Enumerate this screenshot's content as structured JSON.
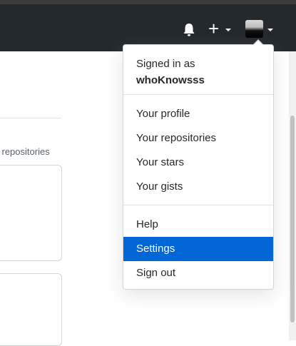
{
  "header": {
    "plus_symbol": "+",
    "icons": {
      "notifications": "bell-icon",
      "create": "plus-icon",
      "avatar": "avatar-image"
    },
    "colors": {
      "header_bg": "#24292e",
      "accent": "#0366d6"
    }
  },
  "background": {
    "repositories_text": "l repositories"
  },
  "user_menu": {
    "signed_in_label": "Signed in as",
    "username": "whoKnowsss",
    "items_group1": [
      "Your profile",
      "Your repositories",
      "Your stars",
      "Your gists"
    ],
    "items_group2": [
      "Help",
      "Settings",
      "Sign out"
    ],
    "active_item": "Settings"
  }
}
